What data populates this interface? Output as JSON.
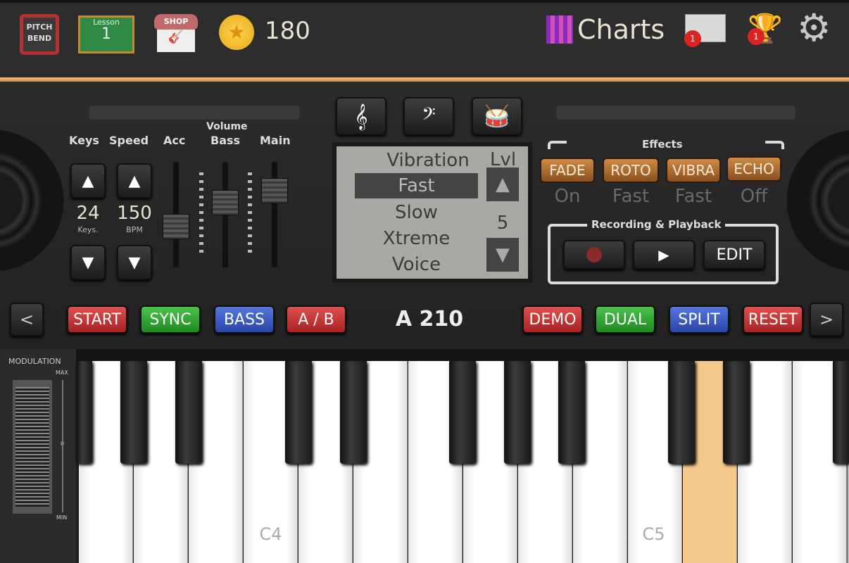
{
  "topbar": {
    "pitch_bend": "PITCH BEND",
    "lesson_label": "Lesson",
    "lesson_number": "1",
    "shop_label": "SHOP",
    "coins": "180",
    "charts": "Charts",
    "mail_badge": "1",
    "trophy_badge": "1"
  },
  "controls": {
    "keys_label": "Keys",
    "speed_label": "Speed",
    "keys_value": "24",
    "keys_unit": "Keys.",
    "speed_value": "150",
    "speed_unit": "BPM",
    "volume_label": "Volume",
    "acc_label": "Acc",
    "bass_label": "Bass",
    "main_label": "Main",
    "acc_level": 0.35,
    "bass_level": 0.65,
    "main_level": 0.8
  },
  "display": {
    "title": "Vibration",
    "items": [
      "Fast",
      "Slow",
      "Xtreme",
      "Voice"
    ],
    "selected": "Fast",
    "lvl_label": "Lvl",
    "lvl_value": "5"
  },
  "effects": {
    "title": "Effects",
    "buttons": [
      {
        "label": "FADE",
        "value": "On"
      },
      {
        "label": "ROTO",
        "value": "Fast"
      },
      {
        "label": "VIBRA",
        "value": "Fast"
      },
      {
        "label": "ECHO",
        "value": "Off"
      }
    ]
  },
  "recording": {
    "title": "Recording & Playback",
    "edit": "EDIT"
  },
  "row": {
    "prev": "<",
    "next": ">",
    "start": "START",
    "sync": "SYNC",
    "bass": "BASS",
    "ab": "A / B",
    "model": "A 210",
    "demo": "DEMO",
    "dual": "DUAL",
    "split": "SPLIT",
    "reset": "RESET"
  },
  "modulation": {
    "title": "MODULATION",
    "max": "MAX",
    "zero": "0",
    "min": "MIN"
  },
  "keyboard": {
    "c4": "C4",
    "c5": "C5",
    "pressed_color": "#f5c98a"
  }
}
